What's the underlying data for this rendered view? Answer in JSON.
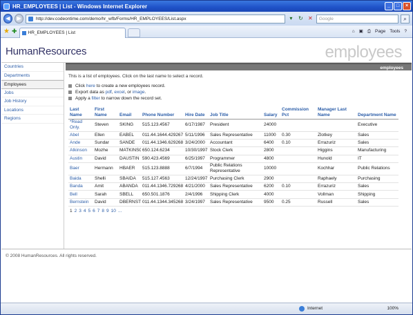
{
  "window": {
    "title": "HR_EMPLOYEES | List - Windows Internet Explorer"
  },
  "address": {
    "url": "http://dev.codeontime.com/demo/hr_wfb/Forms/HR_EMPLOYEES/List.aspx",
    "search_placeholder": "Google"
  },
  "tab": {
    "label": "HR_EMPLOYEES | List"
  },
  "toolbar": {
    "items": [
      "Page",
      "Tools"
    ]
  },
  "site": {
    "name": "HumanResources",
    "page_title": "employees"
  },
  "nav": {
    "items": [
      "Countries",
      "Departments",
      "Employees",
      "Jobs",
      "Job History",
      "Locations",
      "Regions"
    ]
  },
  "main": {
    "banner": "employees",
    "description": "This is a list of employees. Click on the last name to select a record.",
    "action1_pre": "Click",
    "action1_link": "here",
    "action1_post": "to create a new employees record.",
    "action2_pre": "Export data as",
    "action2_l1": "pdf",
    "action2_l2": "excel",
    "action2_mid": ", or",
    "action2_l3": "image",
    "action3_pre": "Apply a",
    "action3_link": "filter",
    "action3_post": "to narrow down the record set.",
    "columns": [
      "Last Name",
      "First Name",
      "Email",
      "Phone Number",
      "Hire Date",
      "Job Title",
      "Salary",
      "Commission Pct",
      "Manager Last Name",
      "Department Name"
    ],
    "rows": [
      [
        "*Read Only.",
        "Steven",
        "SKING",
        "515.123.4567",
        "6/17/1987",
        "President",
        "24000",
        "",
        "",
        "Executive"
      ],
      [
        "Abel",
        "Ellen",
        "EABEL",
        "011.44.1644.429267",
        "5/11/1996",
        "Sales Representative",
        "11000",
        "0.30",
        "Zlotkey",
        "Sales"
      ],
      [
        "Ande",
        "Sundar",
        "SANDE",
        "011.44.1346.629268",
        "3/24/2000",
        "Accountant",
        "6400",
        "0.10",
        "Errazuriz",
        "Sales"
      ],
      [
        "Atkinson",
        "Mozhe",
        "MATKINSO",
        "650.124.6234",
        "10/30/1997",
        "Stock Clerk",
        "2800",
        "",
        "Higgins",
        "Manufacturing"
      ],
      [
        "Austin",
        "David",
        "DAUSTIN",
        "590.423.4569",
        "6/25/1997",
        "Programmer",
        "4800",
        "",
        "Hunold",
        "IT"
      ],
      [
        "Baer",
        "Hermann",
        "HBAER",
        "515.123.8888",
        "6/7/1994",
        "Public Relations Representative",
        "10000",
        "",
        "Kochhar",
        "Public Relations"
      ],
      [
        "Baida",
        "Shelli",
        "SBAIDA",
        "515.127.4563",
        "12/24/1997",
        "Purchasing Clerk",
        "2900",
        "",
        "Raphaely",
        "Purchasing"
      ],
      [
        "Banda",
        "Amit",
        "ABANDA",
        "011.44.1346.729268",
        "4/21/2000",
        "Sales Representative",
        "6200",
        "0.10",
        "Errazuriz",
        "Sales"
      ],
      [
        "Bell",
        "Sarah",
        "SBELL",
        "650.501.1876",
        "2/4/1996",
        "Shipping Clerk",
        "4000",
        "",
        "Vollman",
        "Shipping"
      ],
      [
        "Bernstein",
        "David",
        "DBERNSTE",
        "011.44.1344.345268",
        "3/24/1997",
        "Sales Representative",
        "9500",
        "0.25",
        "Russell",
        "Sales"
      ]
    ],
    "pager": [
      "1",
      "2",
      "3",
      "4",
      "5",
      "6",
      "7",
      "8",
      "9",
      "10",
      "..."
    ]
  },
  "footer": {
    "copyright": "© 2008 HumanResources. All rights reserved."
  },
  "status": {
    "zone": "Internet",
    "zoom": "100%"
  }
}
